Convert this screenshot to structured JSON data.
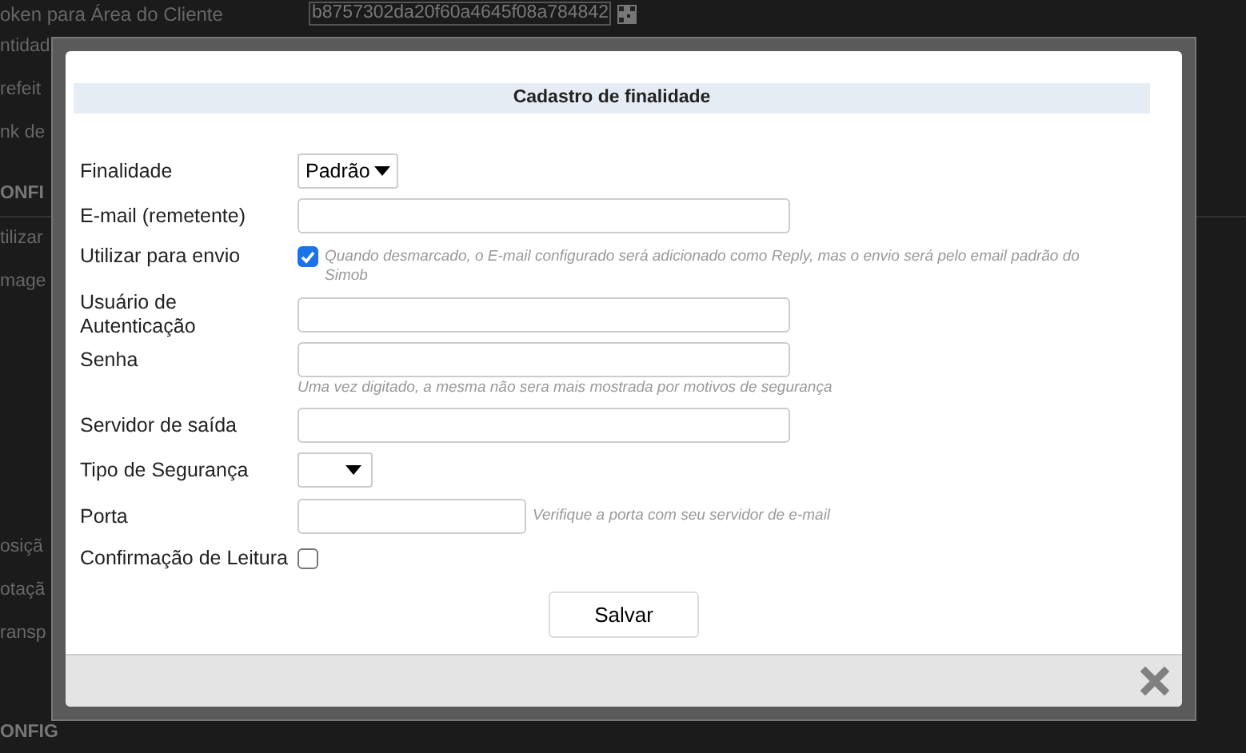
{
  "background": {
    "sections": [
      {
        "rows": [
          {
            "kind": "field",
            "label": "oken para Área do Cliente",
            "value": "b8757302da20f60a4645f08a784842"
          },
          {
            "kind": "text",
            "label": "ntidad"
          },
          {
            "kind": "text",
            "label": "refeit"
          },
          {
            "kind": "text",
            "label": "nk de"
          }
        ]
      },
      {
        "rows": [
          {
            "kind": "heading",
            "label": "ONFI"
          },
          {
            "kind": "text",
            "label": "tilizar"
          },
          {
            "kind": "text",
            "label": "mage"
          }
        ]
      },
      {
        "rows": [
          {
            "kind": "text",
            "label": "osiçã"
          },
          {
            "kind": "text",
            "label": "otaçã"
          },
          {
            "kind": "text",
            "label": "ransp"
          }
        ]
      },
      {
        "rows": [
          {
            "kind": "heading",
            "label": "ONFIG"
          }
        ]
      }
    ]
  },
  "dialog": {
    "title": "Cadastro de finalidade",
    "fields": [
      {
        "kind": "select",
        "label": "Finalidade",
        "value": "Padrão"
      },
      {
        "kind": "input",
        "label": "E-mail (remetente)"
      },
      {
        "kind": "checkbox",
        "label": "Utilizar para envio",
        "checked": true,
        "hint": "Quando desmarcado, o E-mail configurado será adicionado como Reply, mas o envio será pelo email padrão do Simob"
      },
      {
        "kind": "input",
        "label": "Usuário de Autenticação"
      },
      {
        "kind": "input",
        "label": "Senha",
        "hint": "Uma vez digitado, a mesma não sera mais mostrada por motivos de segurança"
      },
      {
        "kind": "input",
        "label": "Servidor de saída"
      },
      {
        "kind": "select",
        "label": "Tipo de Segurança"
      },
      {
        "kind": "short-input",
        "label": "Porta",
        "hint": "Verifique a porta com seu servidor de e-mail"
      },
      {
        "kind": "checkbox",
        "label": "Confirmação de Leitura",
        "checked": false
      }
    ],
    "save_button": "Salvar"
  }
}
